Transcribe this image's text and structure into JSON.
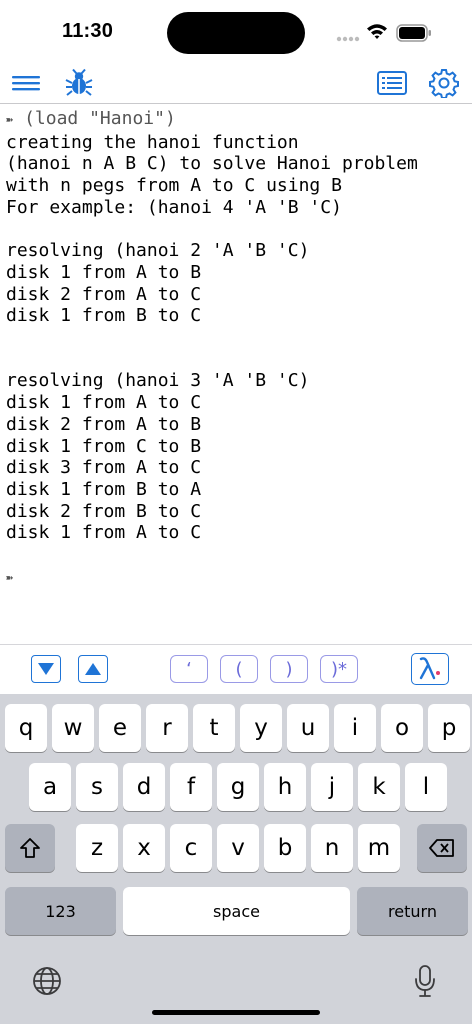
{
  "status": {
    "time": "11:30",
    "signal_icon": "cellular-signal-icon",
    "wifi_icon": "wifi-icon",
    "battery_icon": "battery-icon"
  },
  "toolbar": {
    "menu_icon": "hamburger-menu-icon",
    "debug_icon": "bug-icon",
    "listing_icon": "text-listing-icon",
    "settings_icon": "gear-icon",
    "accent": "#1f74d6"
  },
  "console": {
    "lines": [
      "(load \"Hanoi\")",
      "creating the hanoi function",
      "(hanoi n A B C) to solve Hanoi problem",
      "with n pegs from A to C using B",
      "For example: (hanoi 4 'A 'B 'C)",
      "",
      "resolving (hanoi 2 'A 'B 'C)",
      "disk 1 from A to B",
      "disk 2 from A to C",
      "disk 1 from B to C",
      "",
      "",
      "resolving (hanoi 3 'A 'B 'C)",
      "disk 1 from A to C",
      "disk 2 from A to B",
      "disk 1 from C to B",
      "disk 3 from A to C",
      "disk 1 from B to A",
      "disk 2 from B to C",
      "disk 1 from A to C",
      "",
      ""
    ],
    "prompt_symbol": "➽",
    "prompt_lines": [
      0,
      21
    ]
  },
  "accessory": {
    "down_icon": "triangle-down-icon",
    "up_icon": "triangle-up-icon",
    "quote": "‘",
    "open_paren": "(",
    "close_paren": ")",
    "close_all": ")*",
    "lambda_icon": "lambda-icon",
    "paren_color": "#6b6bd9"
  },
  "keyboard": {
    "row1": [
      "q",
      "w",
      "e",
      "r",
      "t",
      "y",
      "u",
      "i",
      "o",
      "p"
    ],
    "row2": [
      "a",
      "s",
      "d",
      "f",
      "g",
      "h",
      "j",
      "k",
      "l"
    ],
    "row3": [
      "z",
      "x",
      "c",
      "v",
      "b",
      "n",
      "m"
    ],
    "shift_icon": "shift-icon",
    "delete_icon": "delete-backspace-icon",
    "numbers": "123",
    "space": "space",
    "return": "return",
    "globe_icon": "globe-icon",
    "mic_icon": "microphone-icon"
  }
}
